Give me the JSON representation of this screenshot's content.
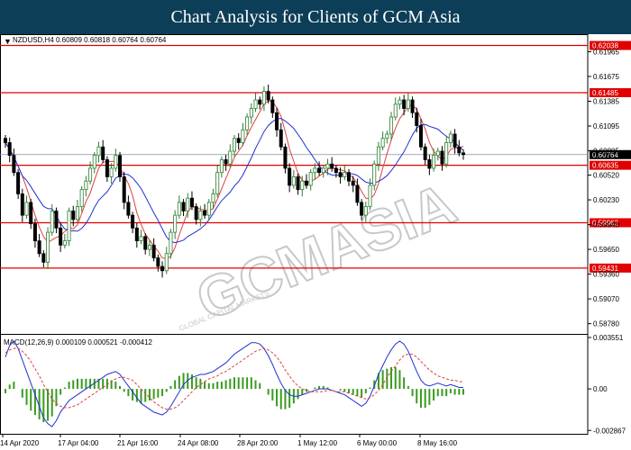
{
  "banner": {
    "title": "Chart Analysis for Clients of GCM Asia"
  },
  "chart_data": {
    "type": "candlestick",
    "symbol_line": "NZDUSD,H4  0.60809 0.60818 0.60764 0.60764",
    "current_price_label": "0.60764",
    "price_axis": {
      "ticks": [
        "0.61965",
        "0.61675",
        "0.61385",
        "0.61095",
        "0.60805",
        "0.60520",
        "0.60230",
        "0.59940",
        "0.59650",
        "0.59360",
        "0.59070",
        "0.58780"
      ],
      "tick_values": [
        0.61965,
        0.61675,
        0.61385,
        0.61095,
        0.60805,
        0.6052,
        0.6023,
        0.5994,
        0.5965,
        0.5936,
        0.5907,
        0.5878
      ],
      "ylim": [
        0.5866,
        0.6217
      ]
    },
    "levels": [
      {
        "label": "0.62038",
        "value": 0.62038
      },
      {
        "label": "0.61485",
        "value": 0.61485
      },
      {
        "label": "0.60635",
        "value": 0.60635
      },
      {
        "label": "0.59962",
        "value": 0.59962
      },
      {
        "label": "0.59431",
        "value": 0.59431
      }
    ],
    "level_color": "#e00000",
    "time_labels": [
      "14 Apr 2020",
      "17 Apr 04:00",
      "21 Apr 16:00",
      "24 Apr 08:00",
      "28 Apr 20:00",
      "1 May 12:00",
      "6 May 00:00",
      "8 May 16:00"
    ],
    "closes": [
      0.609,
      0.6075,
      0.6055,
      0.603,
      0.6005,
      0.602,
      0.5995,
      0.5975,
      0.596,
      0.595,
      0.5985,
      0.601,
      0.599,
      0.597,
      0.5975,
      0.601,
      0.6,
      0.6015,
      0.6035,
      0.6045,
      0.606,
      0.6075,
      0.6085,
      0.607,
      0.605,
      0.606,
      0.6075,
      0.605,
      0.602,
      0.6005,
      0.599,
      0.5975,
      0.598,
      0.5965,
      0.597,
      0.5955,
      0.5945,
      0.594,
      0.596,
      0.5985,
      0.6005,
      0.602,
      0.601,
      0.6025,
      0.6015,
      0.6,
      0.601,
      0.6005,
      0.602,
      0.603,
      0.6055,
      0.607,
      0.6065,
      0.608,
      0.6095,
      0.609,
      0.6105,
      0.612,
      0.613,
      0.614,
      0.6135,
      0.615,
      0.614,
      0.6125,
      0.6105,
      0.6085,
      0.606,
      0.604,
      0.605,
      0.6035,
      0.6045,
      0.604,
      0.6055,
      0.606,
      0.6055,
      0.606,
      0.6065,
      0.606,
      0.6055,
      0.605,
      0.6055,
      0.6045,
      0.604,
      0.602,
      0.6005,
      0.6015,
      0.604,
      0.6065,
      0.6085,
      0.6095,
      0.61,
      0.612,
      0.6135,
      0.614,
      0.613,
      0.614,
      0.6125,
      0.611,
      0.6085,
      0.607,
      0.606,
      0.6075,
      0.608,
      0.6065,
      0.609,
      0.61,
      0.6085,
      0.6078,
      0.6076
    ],
    "macd": {
      "label": "MACD(12,26,9) 0.000109 0.000521 -0.000412",
      "axis_ticks": [
        "0.003551",
        "0.00",
        "-0.002867"
      ],
      "axis_values": [
        0.003551,
        0.0,
        -0.002867
      ],
      "ylim": [
        -0.0031,
        0.0038
      ],
      "main": [
        0.0022,
        0.003,
        0.0033,
        0.0028,
        0.002,
        0.0012,
        0.0004,
        -0.0004,
        -0.0012,
        -0.002,
        -0.0024,
        -0.0026,
        -0.0022,
        -0.0016,
        -0.0012,
        -0.0008,
        -0.0006,
        -0.0004,
        -0.0002,
        0.0,
        0.0002,
        0.0004,
        0.0006,
        0.0008,
        0.001,
        0.0011,
        0.0012,
        0.001,
        0.0006,
        0.0002,
        -0.0002,
        -0.0006,
        -0.001,
        -0.0012,
        -0.0014,
        -0.0016,
        -0.0017,
        -0.0018,
        -0.0016,
        -0.0012,
        -0.0007,
        -0.0002,
        0.0003,
        0.0006,
        0.0008,
        0.0009,
        0.001,
        0.001,
        0.0011,
        0.0012,
        0.0014,
        0.0016,
        0.0018,
        0.0021,
        0.0024,
        0.0026,
        0.0028,
        0.003,
        0.0032,
        0.0032,
        0.0031,
        0.0028,
        0.0023,
        0.0017,
        0.001,
        0.0004,
        -0.0001,
        -0.0004,
        -0.0005,
        -0.0005,
        -0.0004,
        -0.0003,
        -0.0002,
        -0.0001,
        0.0,
        0.0,
        0.0,
        -0.0001,
        -0.0002,
        -0.0003,
        -0.0004,
        -0.0006,
        -0.0008,
        -0.001,
        -0.0012,
        -0.001,
        -0.0005,
        0.0002,
        0.001,
        0.0016,
        0.0022,
        0.0027,
        0.0031,
        0.0033,
        0.0031,
        0.0026,
        0.0019,
        0.0012,
        0.0006,
        0.0003,
        0.0002,
        0.0003,
        0.0004,
        0.0003,
        0.0002,
        0.0003,
        0.0002,
        0.0001,
        0.0001
      ],
      "signal": [
        0.0025,
        0.0027,
        0.0028,
        0.0028,
        0.0026,
        0.0023,
        0.0019,
        0.0014,
        0.0009,
        0.0003,
        -0.0002,
        -0.0007,
        -0.001,
        -0.0012,
        -0.0013,
        -0.0013,
        -0.0012,
        -0.0011,
        -0.0009,
        -0.0007,
        -0.0005,
        -0.0003,
        -0.0001,
        0.0001,
        0.0003,
        0.0005,
        0.0007,
        0.0008,
        0.0008,
        0.0007,
        0.0006,
        0.0003,
        0.0,
        -0.0003,
        -0.0006,
        -0.0009,
        -0.0011,
        -0.0013,
        -0.0014,
        -0.0014,
        -0.0013,
        -0.0011,
        -0.0008,
        -0.0005,
        -0.0002,
        0.0001,
        0.0003,
        0.0005,
        0.0007,
        0.0008,
        0.0009,
        0.0011,
        0.0012,
        0.0014,
        0.0016,
        0.0018,
        0.002,
        0.0022,
        0.0024,
        0.0026,
        0.0027,
        0.0028,
        0.0027,
        0.0025,
        0.0022,
        0.0018,
        0.0013,
        0.0009,
        0.0005,
        0.0002,
        0.0,
        -0.0001,
        -0.0002,
        -0.0002,
        -0.0002,
        -0.0002,
        -0.0001,
        -0.0001,
        -0.0002,
        -0.0002,
        -0.0002,
        -0.0003,
        -0.0004,
        -0.0005,
        -0.0006,
        -0.0007,
        -0.0006,
        -0.0004,
        -0.0001,
        0.0003,
        0.0008,
        0.0012,
        0.0016,
        0.002,
        0.0023,
        0.0024,
        0.0024,
        0.0022,
        0.0019,
        0.0016,
        0.0013,
        0.0011,
        0.0009,
        0.0008,
        0.0007,
        0.0006,
        0.0006,
        0.0005,
        0.0005
      ]
    },
    "colors": {
      "bull": "#2e7d32",
      "bear": "#000000",
      "ma_fast": "#e04040",
      "ma_slow": "#2030d0",
      "macd_line": "#2030d0",
      "signal_line": "#e04040",
      "hist": "#3a9a20",
      "watermark": "#c8c8c8"
    },
    "watermark": {
      "text": "GCMASIA",
      "subtext": "GLOBAL CAPITAL MARKETS"
    }
  }
}
